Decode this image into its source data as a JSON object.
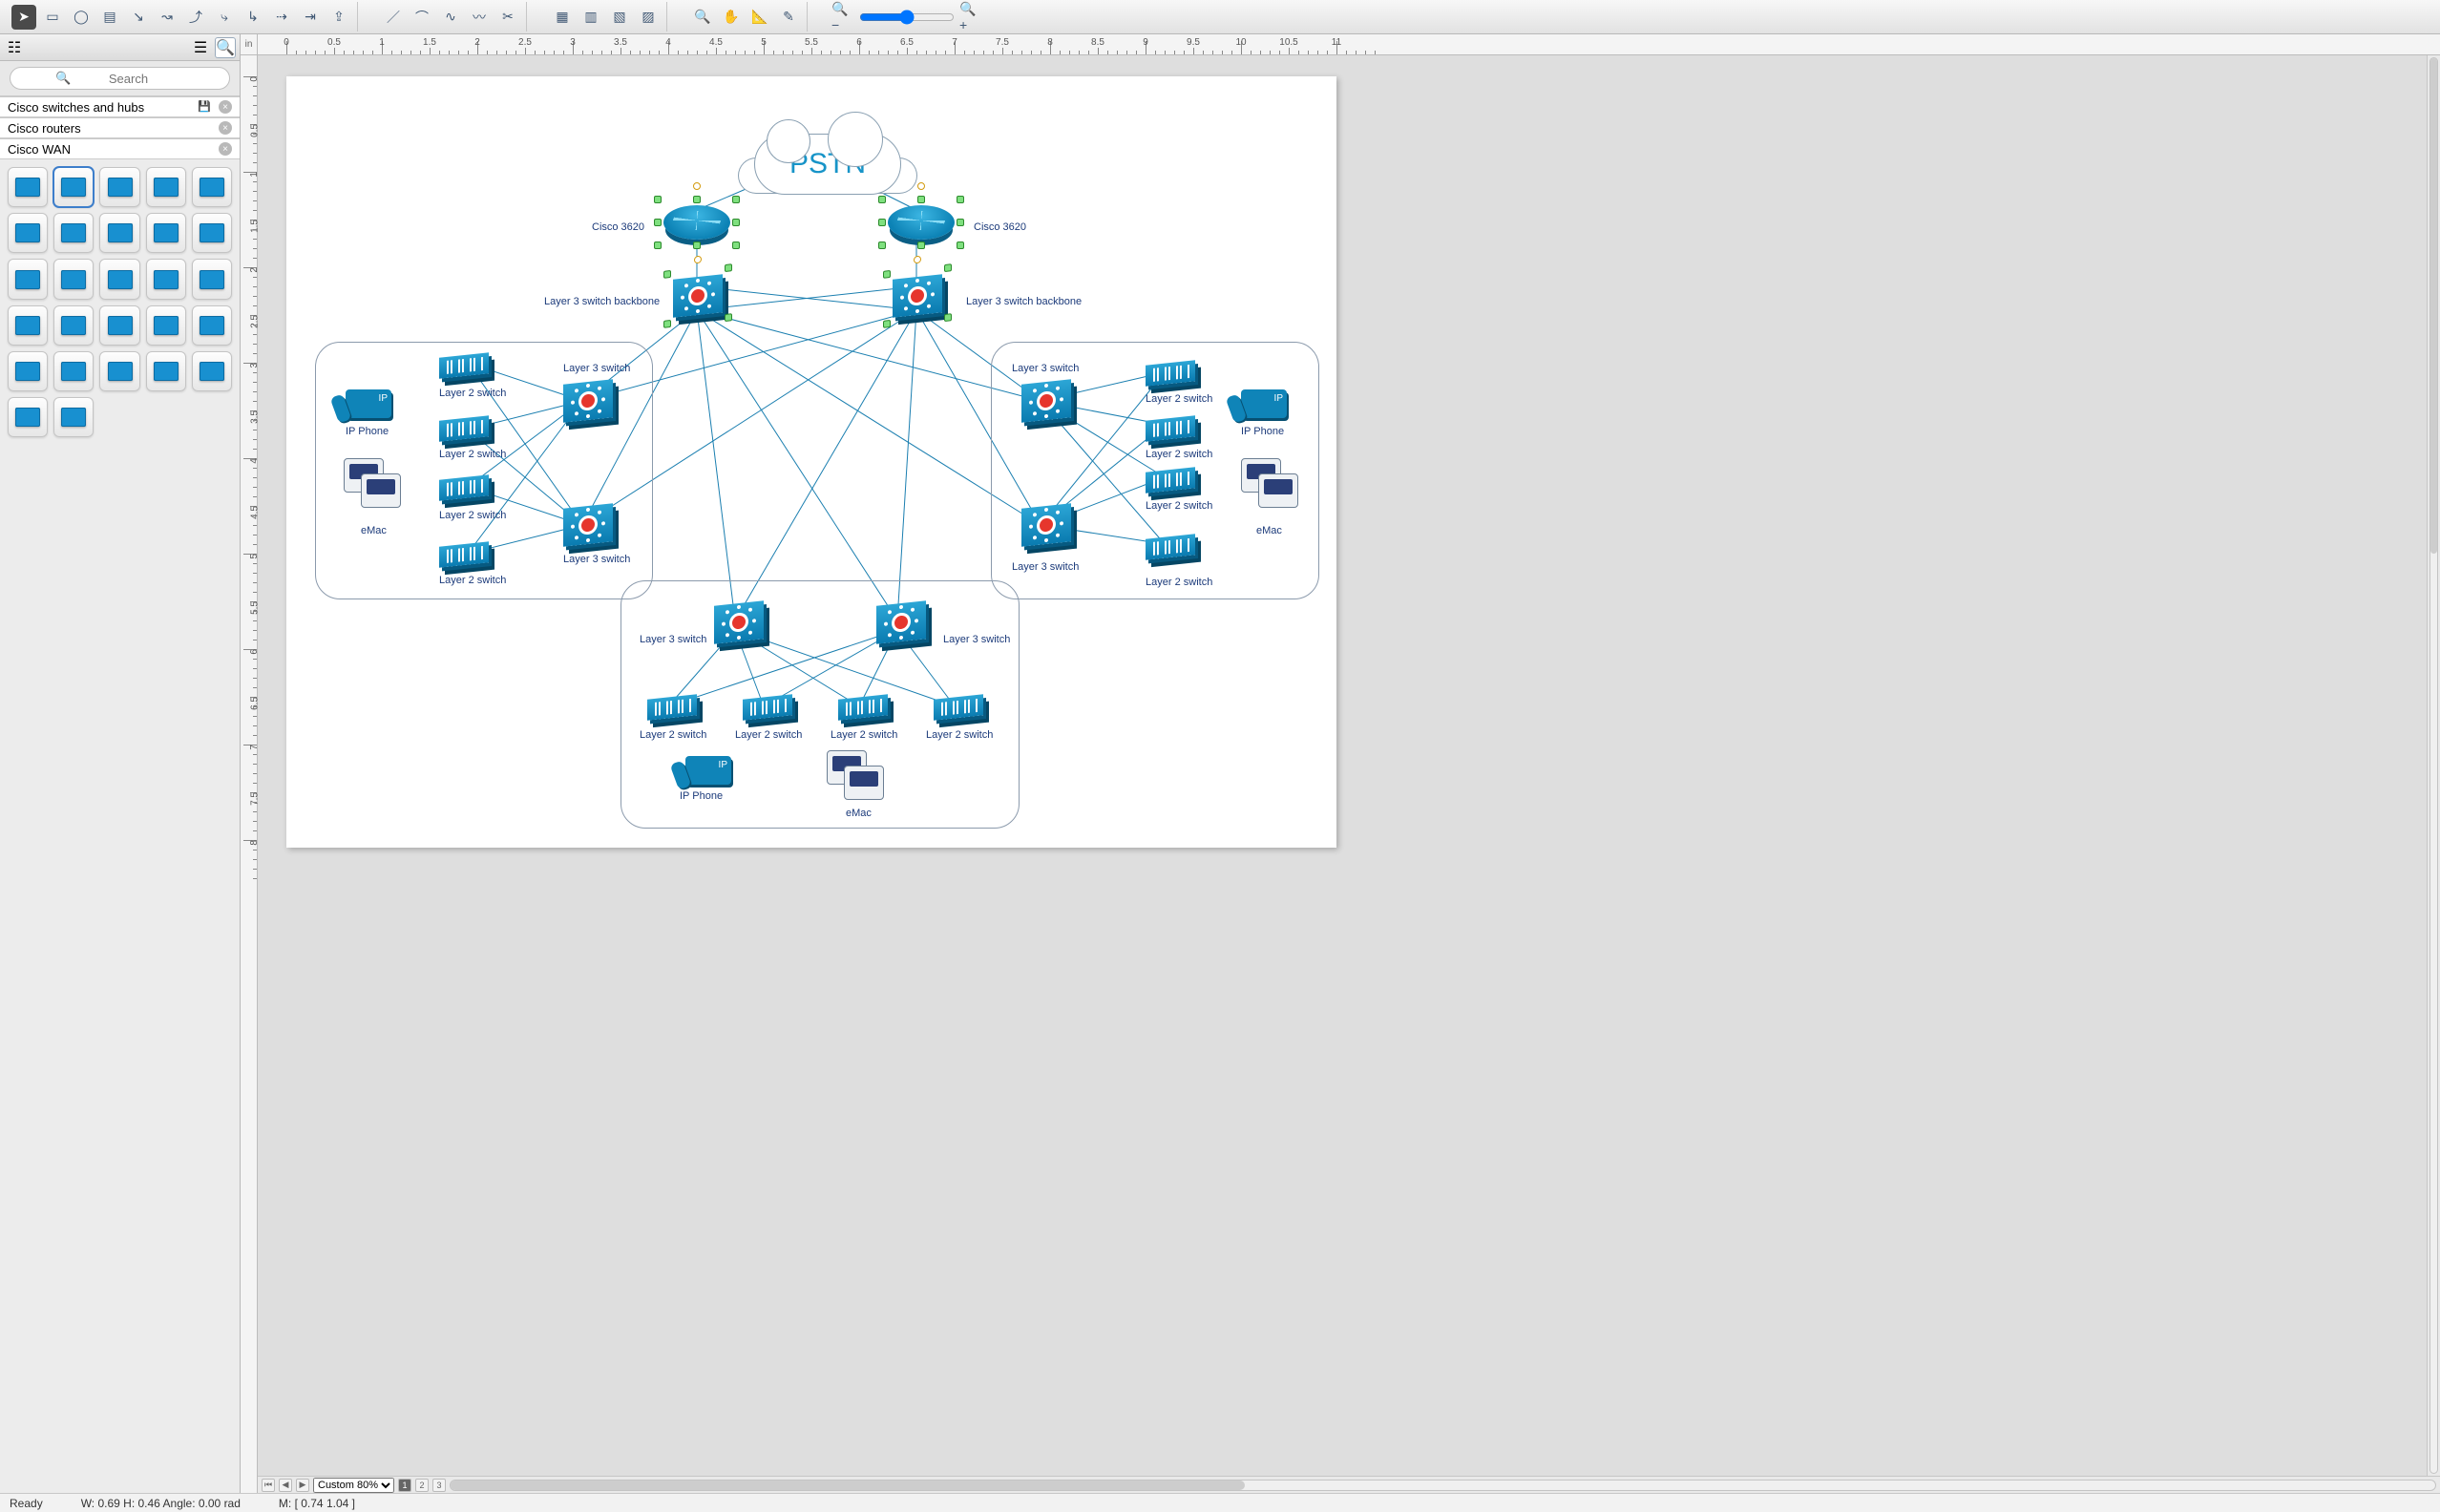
{
  "toolbar": {
    "groups": [
      [
        "pointer",
        "rect",
        "ellipse",
        "text",
        "connector-straight",
        "connector-curve",
        "connector-orth",
        "connector-tree",
        "connector-arc",
        "connector-multi",
        "connector-smart",
        "export"
      ],
      [
        "line-tool",
        "arc-tool",
        "spline-tool",
        "bezier-tool",
        "scissors-tool"
      ],
      [
        "snap-grid",
        "snap-guides",
        "snap-objects",
        "snap-page"
      ],
      [
        "zoom",
        "pan",
        "ruler",
        "eyedropper"
      ]
    ],
    "active": "pointer"
  },
  "zoom": {
    "out_icon": "−",
    "in_icon": "+",
    "value": 50
  },
  "left": {
    "search_placeholder": "Search",
    "libraries": [
      {
        "name": "Cisco switches and hubs",
        "selected": true,
        "has_save": true
      },
      {
        "name": "Cisco routers",
        "selected": false,
        "has_save": false
      },
      {
        "name": "Cisco WAN",
        "selected": false,
        "has_save": false
      }
    ],
    "stencil_count": 27,
    "stencil_selected_index": 1
  },
  "ruler": {
    "unit": "in",
    "h_ticks": [
      0,
      0.5,
      1,
      1.5,
      2,
      2.5,
      3,
      3.5,
      4,
      4.5,
      5,
      5.5,
      6,
      6.5,
      7,
      7.5,
      8,
      8.5,
      9,
      9.5,
      10,
      10.5,
      11
    ],
    "v_ticks": [
      0,
      0.5,
      1,
      1.5,
      2,
      2.5,
      3,
      3.5,
      4,
      4.5,
      5,
      5.5,
      6,
      6.5,
      7,
      7.5,
      8
    ]
  },
  "diagram": {
    "cloud_label": "PSTN",
    "nodes": {
      "cisco_left": "Cisco 3620",
      "cisco_right": "Cisco 3620",
      "backbone_left": "Layer 3 switch backbone",
      "backbone_right": "Layer 3 switch backbone",
      "l3": "Layer 3 switch",
      "l2": "Layer 2 switch",
      "ipphone": "IP Phone",
      "emac": "eMac"
    }
  },
  "bottom": {
    "zoom_select": "Custom 80%",
    "page_tabs": [
      "1",
      "2",
      "3"
    ]
  },
  "status": {
    "ready": "Ready",
    "dims": "W: 0.69   H: 0.46   Angle: 0.00 rad",
    "mouse": "M: [ 0.74   1.04 ]"
  }
}
